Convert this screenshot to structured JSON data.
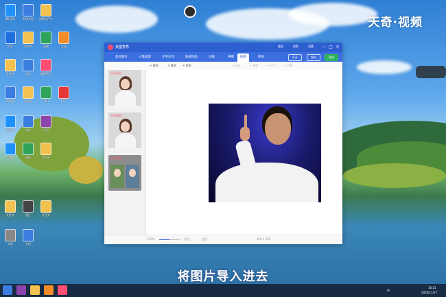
{
  "watermark": "天奇·视频",
  "subtitle": "将图片导入进去",
  "colors": {
    "accent": "#2e5fd1",
    "brand_logo": "#ff4d73",
    "export_button": "#2fb35a"
  },
  "desktop": {
    "icons": [
      {
        "label": "腾讯QQ",
        "icon": "qq-icon",
        "color": "#1e90ff"
      },
      {
        "label": "新建文档",
        "icon": "doc-icon",
        "color": "#3b7de0"
      },
      {
        "label": "新建文件夹",
        "icon": "folder-icon",
        "color": "#f2c14e"
      },
      {
        "label": "钉钉",
        "icon": "app-icon",
        "color": "#1d6fe0"
      },
      {
        "label": "文件夹",
        "icon": "folder-icon",
        "color": "#f2c14e"
      },
      {
        "label": "表格",
        "icon": "xls-icon",
        "color": "#2fa35a"
      },
      {
        "label": "工具",
        "icon": "app-icon",
        "color": "#f28c28"
      },
      {
        "label": "文件夹",
        "icon": "folder-icon",
        "color": "#f2c14e"
      },
      {
        "label": "文档",
        "icon": "doc-icon",
        "color": "#3b7de0"
      },
      {
        "label": "美图秀秀",
        "icon": "app-icon",
        "color": "#ff4d73"
      },
      {
        "label": "浏览器",
        "icon": "app-icon",
        "color": "#3b7de0"
      },
      {
        "label": "文件夹",
        "icon": "folder-icon",
        "color": "#f2c14e"
      },
      {
        "label": "360",
        "icon": "app-icon",
        "color": "#2fa35a"
      },
      {
        "label": "PDF",
        "icon": "app-icon",
        "color": "#e53935"
      },
      {
        "label": "浏览器",
        "icon": "app-icon",
        "color": "#1e90ff"
      },
      {
        "label": "文档",
        "icon": "doc-icon",
        "color": "#3b7de0"
      },
      {
        "label": "应用",
        "icon": "app-icon",
        "color": "#8e44ad"
      },
      {
        "label": "电脑",
        "icon": "app-icon",
        "color": "#1e90ff"
      },
      {
        "label": "表格",
        "icon": "xls-icon",
        "color": "#2fa35a"
      },
      {
        "label": "文件夹",
        "icon": "folder-icon",
        "color": "#f2c14e"
      },
      {
        "label": "文件夹",
        "icon": "folder-icon",
        "color": "#f2c14e"
      },
      {
        "label": "图片",
        "icon": "image-icon",
        "color": "#444444"
      },
      {
        "label": "文件夹",
        "icon": "folder-icon",
        "color": "#f2c14e"
      },
      {
        "label": "文档",
        "icon": "doc-icon",
        "color": "#888888"
      },
      {
        "label": "文档",
        "icon": "doc-icon",
        "color": "#3b7de0"
      }
    ]
  },
  "app": {
    "name": "美图秀秀",
    "title_links": [
      "登录",
      "帮助",
      "设置"
    ],
    "window_buttons": {
      "minimize": "—",
      "maximize": "□",
      "close": "✕"
    },
    "tabs": [
      {
        "label": "美化图片",
        "active": false
      },
      {
        "label": "人像美容",
        "active": false
      },
      {
        "label": "文字水印",
        "active": false
      },
      {
        "label": "贴纸饰品",
        "active": false
      },
      {
        "label": "边框",
        "active": false
      },
      {
        "label": "拼图",
        "active": false
      },
      {
        "label": "抠图",
        "active": true
      },
      {
        "label": "更多",
        "active": false
      }
    ],
    "top_buttons": {
      "open": "打开",
      "save": "保存",
      "export": "保存"
    },
    "toolbar": [
      {
        "label": "撤销",
        "enabled": true
      },
      {
        "label": "重做",
        "enabled": true
      },
      {
        "label": "原图",
        "enabled": true
      },
      {
        "label": "裁剪",
        "enabled": false
      },
      {
        "label": "旋转",
        "enabled": false
      },
      {
        "label": "尺寸",
        "enabled": false
      },
      {
        "label": "背景",
        "enabled": false
      }
    ],
    "side_panel": [
      {
        "label": "自动抠图"
      },
      {
        "label": "手动抠图"
      },
      {
        "label": "形状抠图"
      }
    ],
    "status": {
      "zoom_label": "100%",
      "zoom_level": 0.5,
      "size_text": "400 x 300",
      "compare_label": "对比",
      "fit_label": "适应"
    }
  },
  "taskbar": {
    "items": [
      {
        "icon": "windows-start-icon",
        "color": "#3b7de0"
      },
      {
        "icon": "app-icon",
        "color": "#8e44ad"
      },
      {
        "icon": "chrome-icon",
        "color": "#f2c14e"
      },
      {
        "icon": "app-icon",
        "color": "#f28c28"
      },
      {
        "icon": "meitu-icon",
        "color": "#ff4d73"
      }
    ],
    "time": "16:21",
    "date": "2020/11/27",
    "ime": "中"
  }
}
